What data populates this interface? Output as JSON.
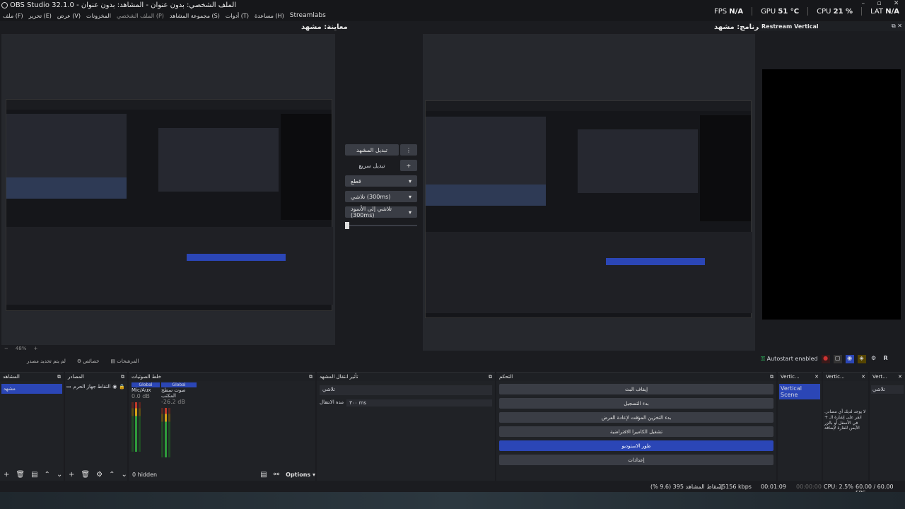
{
  "window": {
    "title": "OBS Studio 32.1.0 - الملف الشخصي: بدون عنوان - المشاهد: بدون عنوان"
  },
  "menu": [
    "ملف (F)",
    "تحرير (E)",
    "عرض (V)",
    "المخزونات",
    "الملف الشخصي (P)",
    "مجموعة المشاهد (S)",
    "أدوات (T)",
    "مساعدة (H)",
    "Streamlabs"
  ],
  "stats": {
    "fps_label": "FPS",
    "fps_value": "N/A",
    "gpu_label": "GPU",
    "gpu_value": "51 °C",
    "cpu_label": "CPU",
    "cpu_value": "21 %",
    "lat_label": "LAT",
    "lat_value": "N/A"
  },
  "preview": {
    "label": "معاينة: مشهد",
    "zoom": "48%"
  },
  "program": {
    "label": "برنامج: مشهد"
  },
  "transitions": {
    "scene_transition": "تبديل المشهد",
    "quick_transition": "تبديل سريع",
    "cut": "قطع",
    "fade": "تلاشي (300ms)",
    "fade_black": "تلاشي إلى الأسود (300ms)"
  },
  "restream": {
    "title": "Restream Vertical",
    "autostart": "Autostart enabled"
  },
  "source_toolbar": {
    "no_source": "لم يتم تحديد مصدر",
    "properties": "خصائص",
    "filters": "المرشحات"
  },
  "docks": {
    "scenes": {
      "title": "المشاهد",
      "items": [
        "مشهد"
      ]
    },
    "sources": {
      "title": "المصادر",
      "items": [
        "التقاط جهاز الحرم"
      ]
    },
    "mixer": {
      "title": "خلط الصوتيات",
      "channels": [
        {
          "badge": "Global",
          "name": "Mic/Aux",
          "db": "0.0 dB",
          "level": 0.0
        },
        {
          "badge": "Global",
          "name": "صوت سطح المكتب",
          "db": "-26.2 dB",
          "level": 0.45
        }
      ],
      "hidden": "0 hidden",
      "options": "Options"
    },
    "transitions": {
      "title": "تأثير انتقال المشهد",
      "type": "تلاشي",
      "duration_label": "مدة الانتقال",
      "duration": "٣٠٠ ms"
    },
    "controls": {
      "title": "التحكم",
      "buttons": [
        "إيقاف البث",
        "بدء التسجيل",
        "بدء التخزين المؤقت لإعادة العرض",
        "تشغيل الكاميرا الافتراضية",
        "طور الاستوديو",
        "إعدادات"
      ]
    },
    "vertical1": {
      "title": "Vertic...",
      "scene": "Vertical Scene"
    },
    "vertical2": {
      "title": "Vertic...",
      "text": "لا يوجد لديك أي مصادر. انقر على إشارة الـ + في الأسفل أو بالزر الأيمن للفارة لإضافة"
    },
    "vertical3": {
      "title": "Vert...",
      "select": "تلاشي"
    }
  },
  "statusbar": {
    "dropped": "إسقاط المشاهد 395 (9.6 %)",
    "bitrate": "15156 kbps",
    "time1": "00:01:09",
    "time2": "00:00:00",
    "cpu": "CPU: 2.5%",
    "fps": "60.00 / 60.00 FPS"
  },
  "colors": {
    "accent": "#2b46b6",
    "bg": "#1b1c20"
  }
}
